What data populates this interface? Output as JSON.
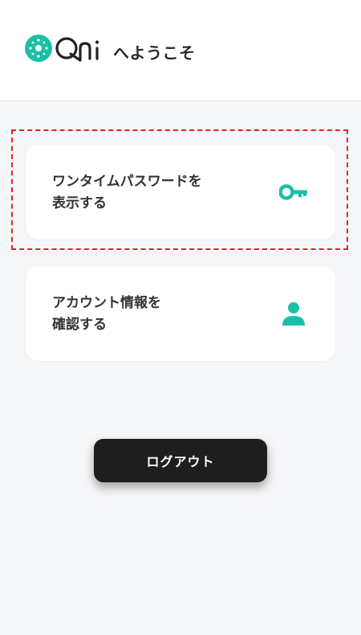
{
  "header": {
    "brand": "Qni",
    "welcome_text": "へようこそ"
  },
  "cards": [
    {
      "label_line1": "ワンタイムパスワードを",
      "label_line2": "表示する",
      "icon": "key-icon",
      "highlighted": true
    },
    {
      "label_line1": "アカウント情報を",
      "label_line2": "確認する",
      "icon": "user-icon",
      "highlighted": false
    }
  ],
  "logout": {
    "label": "ログアウト"
  },
  "colors": {
    "accent": "#1bbfa8",
    "highlight_border": "#e52222",
    "background": "#f5f6f8",
    "button": "#1e1e1e"
  }
}
